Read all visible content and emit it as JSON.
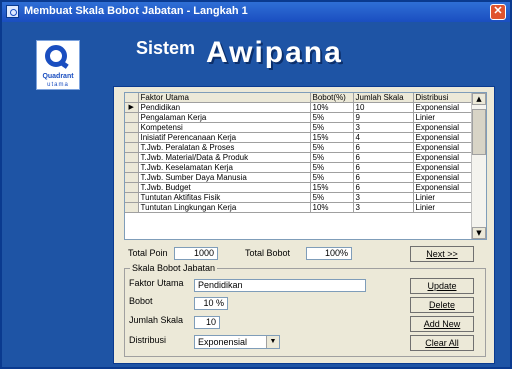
{
  "window": {
    "title": "Membuat Skala Bobot Jabatan - Langkah 1",
    "close_glyph": "✕"
  },
  "logo": {
    "brand": "Quadrant",
    "sub": "utama"
  },
  "header": {
    "title_small": "Sistem",
    "title_big": "Awipana"
  },
  "grid": {
    "columns": [
      "Faktor Utama",
      "Bobot(%)",
      "Jumlah Skala",
      "Distribusi"
    ],
    "rows": [
      [
        "Pendidikan",
        "10%",
        "10",
        "Exponensial"
      ],
      [
        "Pengalaman Kerja",
        "5%",
        "9",
        "Linier"
      ],
      [
        "Kompetensi",
        "5%",
        "3",
        "Exponensial"
      ],
      [
        "Inisiatif Perencanaan Kerja",
        "15%",
        "4",
        "Exponensial"
      ],
      [
        "T.Jwb. Peralatan & Proses",
        "5%",
        "6",
        "Exponensial"
      ],
      [
        "T.Jwb. Material/Data & Produk",
        "5%",
        "6",
        "Exponensial"
      ],
      [
        "T.Jwb. Keselamatan Kerja",
        "5%",
        "6",
        "Exponensial"
      ],
      [
        "T.Jwb. Sumber Daya Manusia",
        "5%",
        "6",
        "Exponensial"
      ],
      [
        "T.Jwb. Budget",
        "15%",
        "6",
        "Exponensial"
      ],
      [
        "Tuntutan Aktifitas Fisik",
        "5%",
        "3",
        "Linier"
      ],
      [
        "Tuntutan Lingkungan Kerja",
        "10%",
        "3",
        "Linier"
      ]
    ],
    "current_row_marker": "▶",
    "scroll_up": "▲",
    "scroll_down": "▼"
  },
  "totals": {
    "poin_label": "Total Poin",
    "poin_value": "1000",
    "bobot_label": "Total Bobot",
    "bobot_value": "100%"
  },
  "buttons": {
    "next": "Next >>",
    "update": "Update",
    "delete": "Delete",
    "add_new": "Add New",
    "clear_all": "Clear All"
  },
  "form": {
    "legend": "Skala Bobot Jabatan",
    "faktor_label": "Faktor Utama",
    "faktor_value": "Pendidikan",
    "bobot_label": "Bobot",
    "bobot_value": "10 %",
    "jumlah_label": "Jumlah Skala",
    "jumlah_value": "10",
    "distribusi_label": "Distribusi",
    "distribusi_value": "Exponensial",
    "dropdown_glyph": "▼"
  },
  "colors": {
    "window_bg": "#1e54a5",
    "titlebar": "#2f6fd6",
    "panel": "#ece9d8",
    "close": "#e0542f"
  }
}
